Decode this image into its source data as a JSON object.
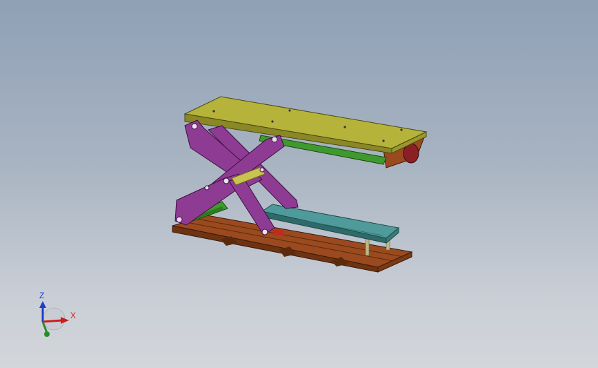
{
  "colors": {
    "top_platform": "#b6b33a",
    "lift_arm": "#8e3c93",
    "cylinder": "#3f9a2e",
    "base_frame": "#9a4a1e",
    "carriage": "#4f9a9a",
    "stop_knob": "#8a1f24",
    "axis_x": "#c81e1e",
    "axis_y": "#2a8a2a",
    "axis_z": "#1e3ec8"
  },
  "triad": {
    "x_label": "X",
    "z_label": "Z"
  }
}
